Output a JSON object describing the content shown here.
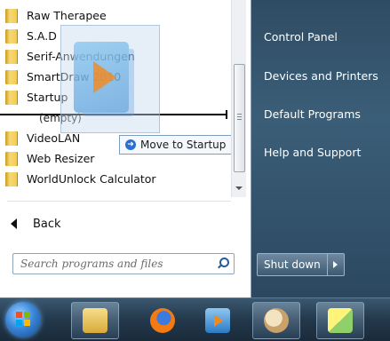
{
  "programs": {
    "items": [
      {
        "label": "Raw Therapee"
      },
      {
        "label": "S.A.D"
      },
      {
        "label": "Serif-Anwendungen"
      },
      {
        "label": "SmartDraw 2010"
      },
      {
        "label": "Startup"
      },
      {
        "label": "(empty)"
      },
      {
        "label": "VideoLAN"
      },
      {
        "label": "Web Resizer"
      },
      {
        "label": "WorldUnlock Calculator"
      }
    ],
    "drag_tooltip": "Move to Startup",
    "back_label": "Back"
  },
  "search": {
    "placeholder": "Search programs and files",
    "value": ""
  },
  "right_pane": {
    "items": [
      {
        "label": "Control Panel"
      },
      {
        "label": "Devices and Printers"
      },
      {
        "label": "Default Programs"
      },
      {
        "label": "Help and Support"
      }
    ],
    "shutdown_label": "Shut down"
  },
  "taskbar": {
    "start_icon": "windows-orb-icon",
    "pinned": [
      {
        "icon": "explorer-icon"
      },
      {
        "icon": "firefox-icon"
      },
      {
        "icon": "media-player-icon"
      },
      {
        "icon": "paint-icon"
      },
      {
        "icon": "sticky-notes-icon"
      }
    ]
  },
  "colors": {
    "left_pane_bg": "#ffffff",
    "right_pane_bg": "#3b5e78",
    "taskbar_bg": "#23384b",
    "tooltip_border": "#7e9cbc"
  }
}
